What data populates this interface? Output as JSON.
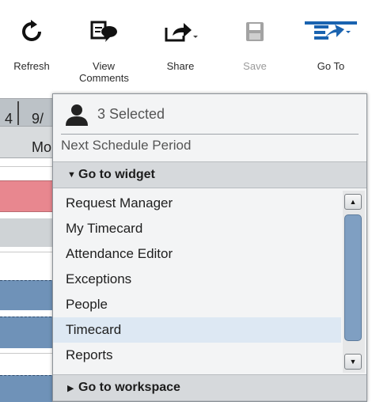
{
  "toolbar": {
    "refresh_label": "Refresh",
    "view_comments_label": "View Comments",
    "share_label": "Share",
    "save_label": "Save",
    "goto_label": "Go To"
  },
  "grid": {
    "date_left": "4",
    "date_right": "9/",
    "day_label": "Mo"
  },
  "popup": {
    "selected_text": "3 Selected",
    "next_period": "Next Schedule Period",
    "widget_header": "Go to widget",
    "widget_items": [
      "Request Manager",
      "My Timecard",
      "Attendance Editor",
      "Exceptions",
      "People",
      "Timecard",
      "Reports"
    ],
    "selected_item": "Timecard",
    "workspace_header": "Go to workspace"
  },
  "colors": {
    "accent": "#1a63b0",
    "selected_item_bg": "#dde8f3",
    "row_pink": "#e8878f",
    "row_blue": "#6f92b8"
  },
  "icons": [
    "refresh-icon",
    "comments-icon",
    "share-icon",
    "save-icon",
    "goto-icon",
    "person-icon",
    "caret-down-icon",
    "caret-right-icon",
    "scroll-up-icon",
    "scroll-down-icon"
  ]
}
